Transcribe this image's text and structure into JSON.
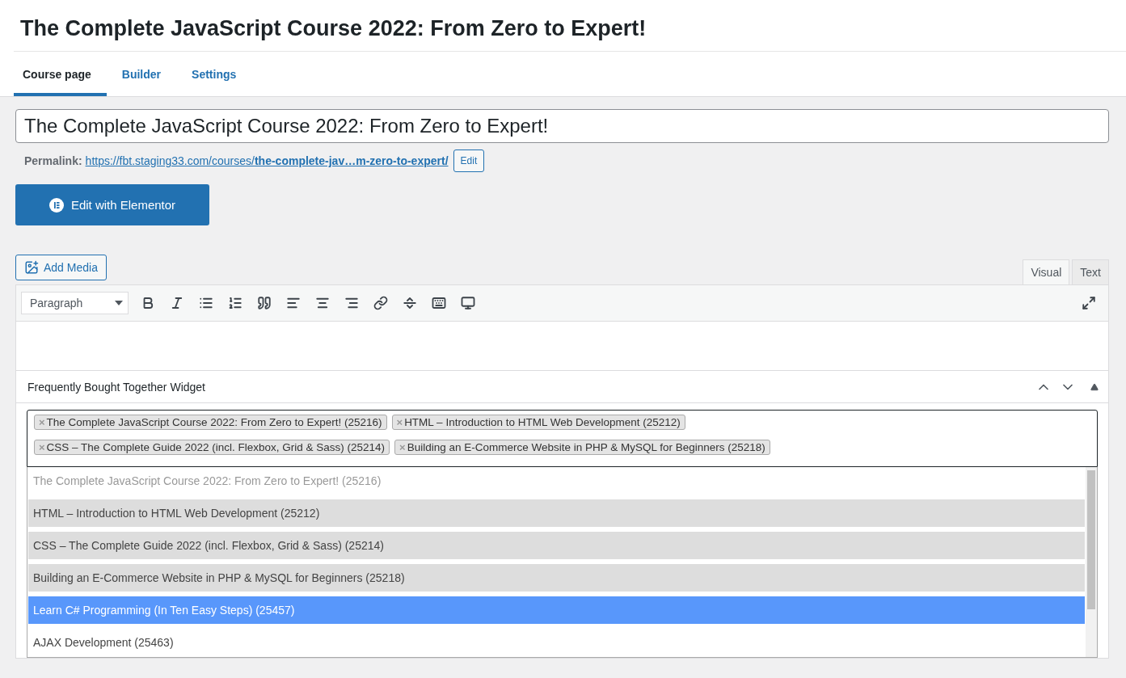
{
  "page_title": "The Complete JavaScript Course 2022: From Zero to Expert!",
  "tabs": [
    {
      "label": "Course page",
      "selected": true
    },
    {
      "label": "Builder",
      "selected": false
    },
    {
      "label": "Settings",
      "selected": false
    }
  ],
  "title_field": {
    "value": "The Complete JavaScript Course 2022: From Zero to Expert!"
  },
  "permalink": {
    "label": "Permalink:",
    "base": "https://fbt.staging33.com/courses/",
    "slug": "the-complete-jav…m-zero-to-expert/",
    "button": "Edit"
  },
  "elementor_button": "Edit with Elementor",
  "add_media": "Add Media",
  "editor_tabs": [
    {
      "label": "Visual",
      "selected": true
    },
    {
      "label": "Text",
      "selected": false
    }
  ],
  "format_select": "Paragraph",
  "widget": {
    "title": "Frequently Bought Together Widget",
    "tags": [
      {
        "remove": "×",
        "label": "The Complete JavaScript Course 2022: From Zero to Expert! (25216)"
      },
      {
        "remove": "×",
        "label": "HTML – Introduction to HTML Web Development (25212)"
      },
      {
        "remove": "×",
        "label": "CSS – The Complete Guide 2022 (incl. Flexbox, Grid & Sass) (25214)"
      },
      {
        "remove": "×",
        "label": "Building an E-Commerce Website in PHP & MySQL for Beginners (25218)"
      }
    ],
    "options": [
      {
        "label": "The Complete JavaScript Course 2022: From Zero to Expert! (25216)",
        "disabled": true,
        "selected": false,
        "highlighted": false
      },
      {
        "label": "HTML – Introduction to HTML Web Development (25212)",
        "disabled": false,
        "selected": true,
        "highlighted": false
      },
      {
        "label": "CSS – The Complete Guide 2022 (incl. Flexbox, Grid & Sass) (25214)",
        "disabled": false,
        "selected": true,
        "highlighted": false
      },
      {
        "label": "Building an E-Commerce Website in PHP & MySQL for Beginners (25218)",
        "disabled": false,
        "selected": true,
        "highlighted": false
      },
      {
        "label": "Learn C# Programming (In Ten Easy Steps) (25457)",
        "disabled": false,
        "selected": false,
        "highlighted": true
      },
      {
        "label": "AJAX Development (25463)",
        "disabled": false,
        "selected": false,
        "highlighted": false
      }
    ]
  }
}
